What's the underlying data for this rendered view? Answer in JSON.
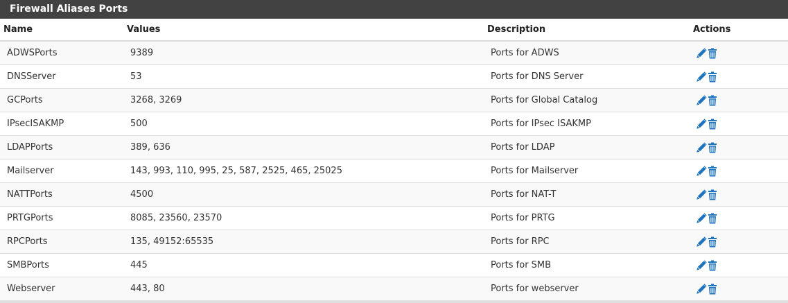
{
  "panel": {
    "title": "Firewall Aliases Ports"
  },
  "columns": {
    "name": "Name",
    "values": "Values",
    "description": "Description",
    "actions": "Actions"
  },
  "colors": {
    "header_bg": "#424242",
    "icon_blue": "#1e73be",
    "row_alt": "#f9f9f9"
  },
  "icons": {
    "edit": "pencil-icon",
    "delete": "trash-icon"
  },
  "rows": [
    {
      "name": "ADWSPorts",
      "values": "9389",
      "description": "Ports for ADWS"
    },
    {
      "name": "DNSServer",
      "values": "53",
      "description": "Ports for DNS Server"
    },
    {
      "name": "GCPorts",
      "values": "3268, 3269",
      "description": "Ports for Global Catalog"
    },
    {
      "name": "IPsecISAKMP",
      "values": "500",
      "description": "Ports for IPsec ISAKMP"
    },
    {
      "name": "LDAPPorts",
      "values": "389, 636",
      "description": "Ports for LDAP"
    },
    {
      "name": "Mailserver",
      "values": "143, 993, 110, 995, 25, 587, 2525, 465, 25025",
      "description": "Ports for Mailserver"
    },
    {
      "name": "NATTPorts",
      "values": "4500",
      "description": "Ports for NAT-T"
    },
    {
      "name": "PRTGPorts",
      "values": "8085, 23560, 23570",
      "description": "Ports for PRTG"
    },
    {
      "name": "RPCPorts",
      "values": "135, 49152:65535",
      "description": "Ports for RPC"
    },
    {
      "name": "SMBPorts",
      "values": "445",
      "description": "Ports for SMB"
    },
    {
      "name": "Webserver",
      "values": "443, 80",
      "description": "Ports for webserver"
    }
  ]
}
